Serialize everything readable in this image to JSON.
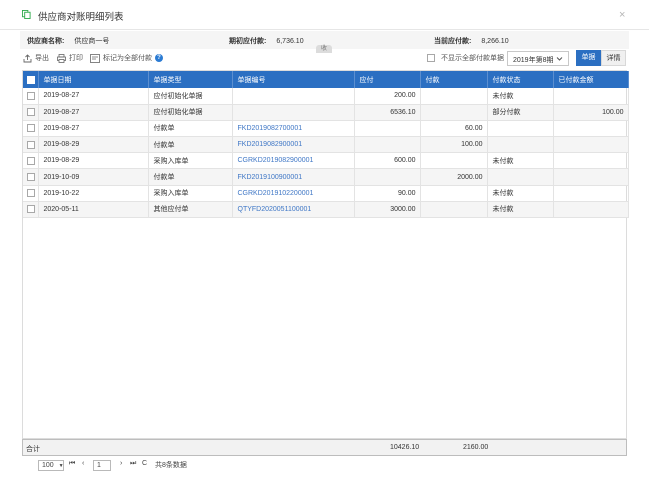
{
  "window": {
    "title": "供应商对账明细列表",
    "close_icon": "×"
  },
  "summary": {
    "supplier_label": "供应商名称:",
    "supplier_value": "供应商一号",
    "opening_label": "期初应付款:",
    "opening_value": "6,736.10",
    "current_label": "当前应付款:",
    "current_value": "8,266.10",
    "collapse_label": "收"
  },
  "toolbar": {
    "export_label": "导出",
    "print_label": "打印",
    "mark_paid_label": "标记为全部付款",
    "hide_paid_label": "不显示全部付款单据",
    "period_value": "2019年第8期",
    "view_doc_label": "单据",
    "view_detail_label": "详情"
  },
  "table": {
    "columns": [
      "单据日期",
      "单据类型",
      "单据编号",
      "应付",
      "付款",
      "付款状态",
      "已付款金额"
    ],
    "rows": [
      {
        "date": "2019-08-27",
        "type": "应付初始化单据",
        "no": "",
        "payable": "200.00",
        "paid": "",
        "status": "未付款",
        "paid_amount": ""
      },
      {
        "date": "2019-08-27",
        "type": "应付初始化单据",
        "no": "",
        "payable": "6536.10",
        "paid": "",
        "status": "部分付款",
        "paid_amount": "100.00"
      },
      {
        "date": "2019-08-27",
        "type": "付款单",
        "no": "FKD2019082700001",
        "payable": "",
        "paid": "60.00",
        "status": "",
        "paid_amount": ""
      },
      {
        "date": "2019-08-29",
        "type": "付款单",
        "no": "FKD2019082900001",
        "payable": "",
        "paid": "100.00",
        "status": "",
        "paid_amount": ""
      },
      {
        "date": "2019-08-29",
        "type": "采购入库单",
        "no": "CGRKD2019082900001",
        "payable": "600.00",
        "paid": "",
        "status": "未付款",
        "paid_amount": ""
      },
      {
        "date": "2019-10-09",
        "type": "付款单",
        "no": "FKD2019100900001",
        "payable": "",
        "paid": "2000.00",
        "status": "",
        "paid_amount": ""
      },
      {
        "date": "2019-10-22",
        "type": "采购入库单",
        "no": "CGRKD2019102200001",
        "payable": "90.00",
        "paid": "",
        "status": "未付款",
        "paid_amount": ""
      },
      {
        "date": "2020-05-11",
        "type": "其他应付单",
        "no": "QTYFD2020051100001",
        "payable": "3000.00",
        "paid": "",
        "status": "未付款",
        "paid_amount": ""
      }
    ]
  },
  "footer": {
    "total_label": "合计",
    "total_payable": "10426.10",
    "total_paid": "2160.00"
  },
  "pager": {
    "page_size": "100",
    "first_icon": "⏮",
    "prev_icon": "‹",
    "current_page": "1",
    "next_icon": "›",
    "last_icon": "⏭",
    "refresh_icon": "C",
    "total_text": "共8条数据"
  },
  "colors": {
    "accent": "#2b6fc2",
    "link": "#3f77c6"
  }
}
